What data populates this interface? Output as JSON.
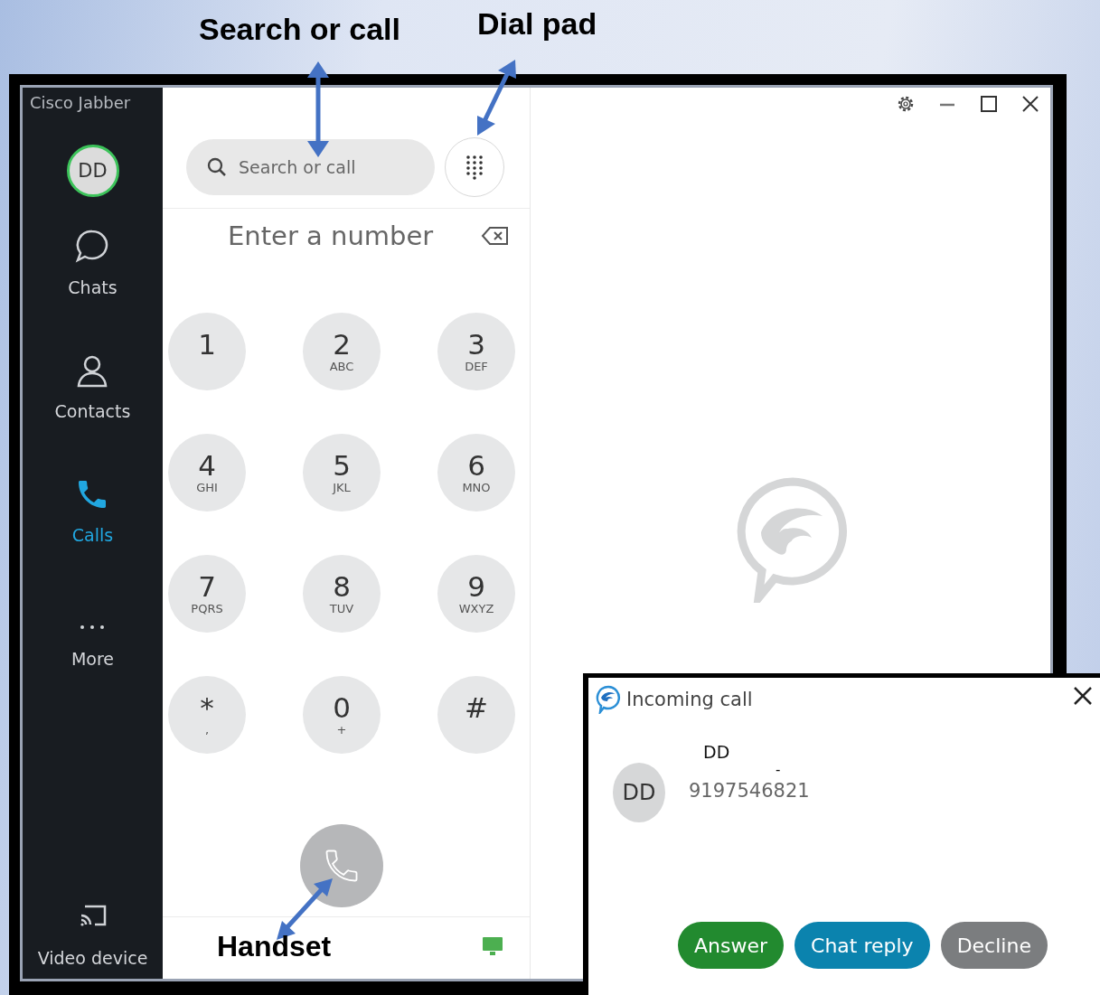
{
  "window": {
    "title": "Cisco Jabber"
  },
  "profile": {
    "initials": "DD"
  },
  "nav": [
    {
      "label": "Chats",
      "kind": "chat",
      "selected": false
    },
    {
      "label": "Contacts",
      "kind": "contact",
      "selected": false
    },
    {
      "label": "Calls",
      "kind": "call",
      "selected": true
    },
    {
      "label": "More",
      "kind": "more",
      "selected": false
    }
  ],
  "bottom_nav": {
    "label": "Video device"
  },
  "search": {
    "placeholder": "Search or call"
  },
  "dialer": {
    "placeholder": "Enter a number"
  },
  "keypad": [
    {
      "digit": "1"
    },
    {
      "digit": "2",
      "letters": "ABC"
    },
    {
      "digit": "3",
      "letters": "DEF"
    },
    {
      "digit": "4",
      "letters": "GHI"
    },
    {
      "digit": "5",
      "letters": "JKL"
    },
    {
      "digit": "6",
      "letters": "MNO"
    },
    {
      "digit": "7",
      "letters": "PQRS"
    },
    {
      "digit": "8",
      "letters": "TUV"
    },
    {
      "digit": "9",
      "letters": "WXYZ"
    },
    {
      "digit": "*",
      "letters": ","
    },
    {
      "digit": "0",
      "letters": "+"
    },
    {
      "digit": "#"
    }
  ],
  "incoming_call": {
    "title": "Incoming call",
    "initials": "DD",
    "name": "DD",
    "separator": "-",
    "number": "9197546821",
    "buttons": [
      {
        "label": "Answer",
        "kind": "answer"
      },
      {
        "label": "Chat reply",
        "kind": "chat"
      },
      {
        "label": "Decline",
        "kind": "decline"
      }
    ]
  },
  "annotations": [
    {
      "text": "Search or call"
    },
    {
      "text": "Dial pad"
    },
    {
      "text": "Handset"
    }
  ]
}
